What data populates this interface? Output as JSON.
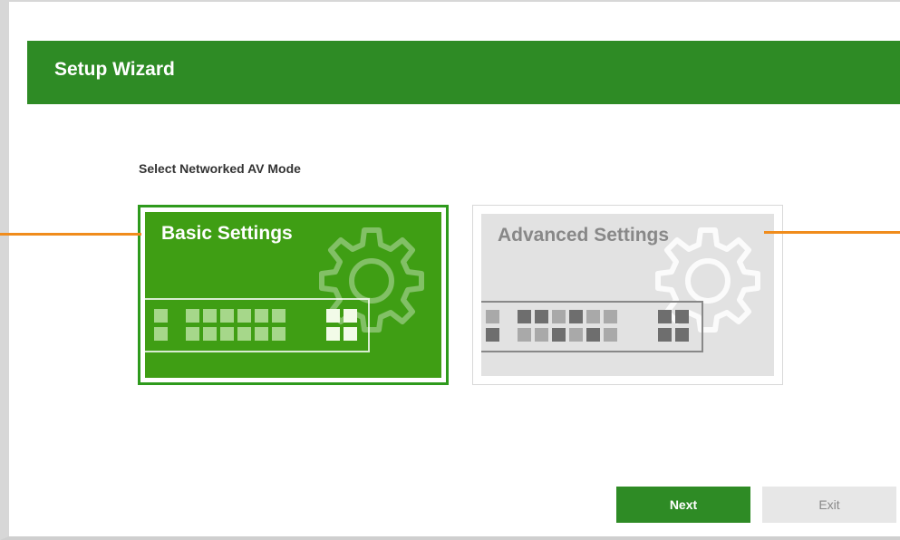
{
  "header": {
    "title": "Setup Wizard"
  },
  "section": {
    "subtitle": "Select Networked AV Mode"
  },
  "cards": {
    "basic": {
      "label": "Basic Settings",
      "selected": true
    },
    "advanced": {
      "label": "Advanced Settings",
      "selected": false
    }
  },
  "buttons": {
    "next_label": "Next",
    "exit_label": "Exit"
  },
  "colors": {
    "brand_green": "#2e8b25",
    "card_green": "#3f9e14",
    "callout_orange": "#f08c1c",
    "disabled_grey": "#e2e2e2"
  },
  "icons": [
    "gear-icon",
    "switch-icon"
  ]
}
